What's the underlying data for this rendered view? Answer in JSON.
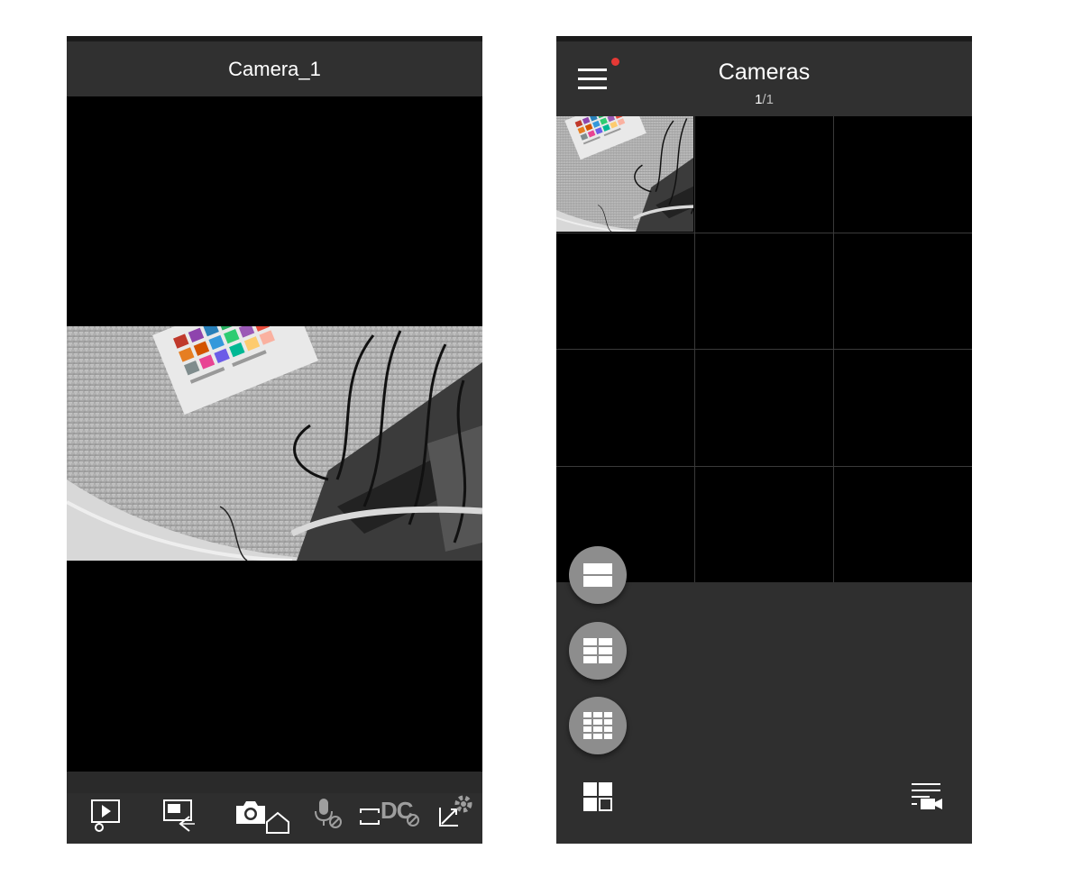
{
  "single_view": {
    "title": "Camera_1",
    "toolbar": {
      "icons": [
        "playback-icon",
        "screen-cast-icon",
        "snapshot-icon",
        "home-icon",
        "mic-muted-icon",
        "record-icon",
        "dewarp-off-icon",
        "fullscreen-icon",
        "ptz-settings-icon"
      ],
      "dewarp_label": "DC"
    }
  },
  "cameras_view": {
    "title": "Cameras",
    "page_current": "1",
    "page_total": "/1",
    "grid": {
      "rows": 4,
      "cols": 3,
      "active_cells": [
        0
      ]
    },
    "layout_fabs": [
      "layout-1x2-icon",
      "layout-2x2-icon",
      "layout-3x3-icon"
    ],
    "bottom": {
      "left_icon": "layout-icon",
      "right_icon": "camera-list-icon"
    }
  },
  "colors": {
    "accent_dot": "#e53935",
    "bar": "#2f2f2f",
    "video_bg": "#000000",
    "fab": "#8d8d8d"
  }
}
